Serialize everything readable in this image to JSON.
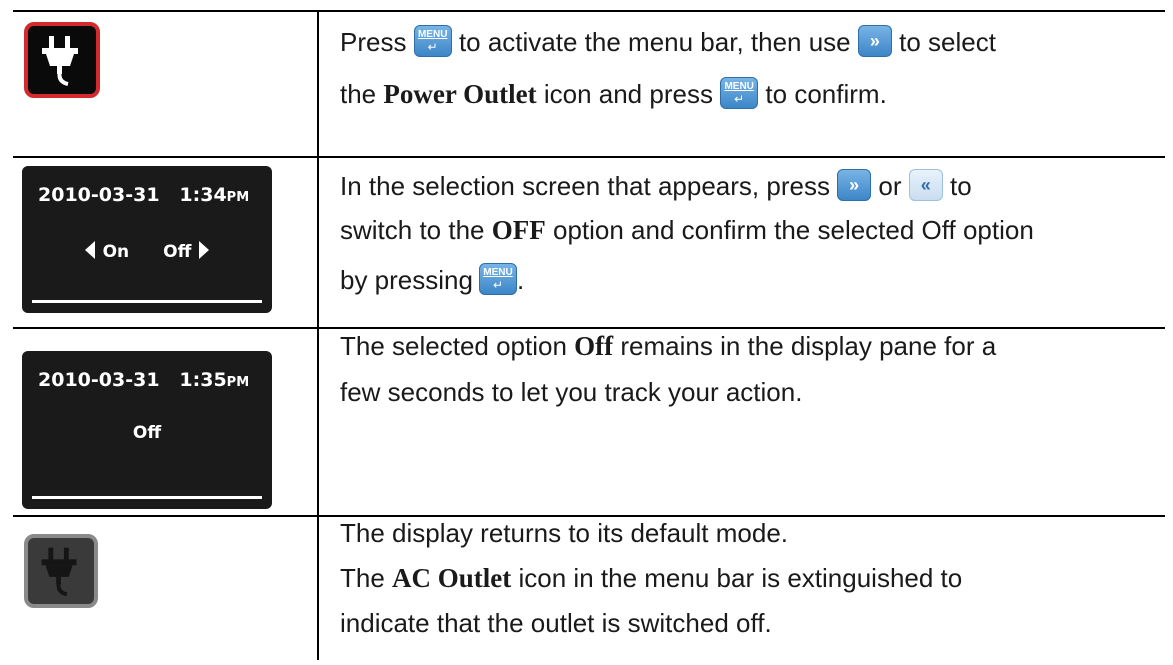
{
  "rows": [
    {
      "text": {
        "p1": "Press",
        "p2": "to activate the menu bar, then use",
        "p3": "to select",
        "p4": "the",
        "bold": "Power Outlet",
        "p5": "icon and press",
        "p6": "to confirm."
      }
    },
    {
      "display": {
        "date": "2010-03-31",
        "time": "1:34",
        "ampm": "PM",
        "opt_on": "On",
        "opt_off": "Off"
      },
      "text": {
        "p1": "In the selection screen that appears, press",
        "or": "or",
        "to": "to",
        "p2": "switch to the",
        "bold": "OFF",
        "p3": "option and confirm the selected Off option",
        "p4": "by pressing",
        "p5": "."
      }
    },
    {
      "display": {
        "date": "2010-03-31",
        "time": "1:35",
        "ampm": "PM",
        "opt": "Off"
      },
      "text": {
        "p1": "The selected option",
        "bold": "Off",
        "p2": "remains in the display pane for a",
        "p3": "few seconds to let you track your action."
      }
    },
    {
      "text": {
        "l1": "The display returns to its default mode.",
        "p1": "The",
        "bold": "AC Outlet",
        "p2": "icon in the menu bar is extinguished to",
        "l3": "indicate that the outlet is switched off."
      }
    }
  ],
  "buttons": {
    "menu_label": "MENU",
    "enter_glyph": "↵",
    "next_glyph": "»",
    "prev_glyph": "«"
  },
  "colors": {
    "accent_red": "#d32b2b",
    "button_blue": "#3c86c8",
    "lcd_bg": "#1a1a1a"
  }
}
